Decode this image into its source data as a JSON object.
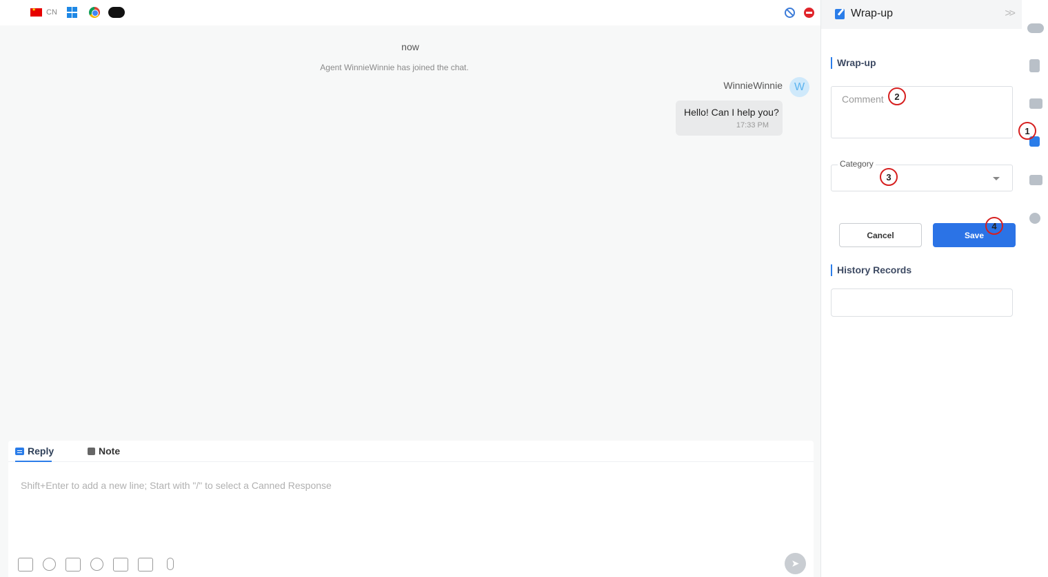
{
  "topbar": {
    "language_code": "CN",
    "icons": [
      "china-flag-icon",
      "windows-icon",
      "chrome-icon",
      "salesforce-icon",
      "block-icon",
      "end-chat-icon"
    ]
  },
  "chat": {
    "timestamp": "now",
    "system_message": "Agent WinnieWinnie has joined the chat.",
    "messages": [
      {
        "sender": "WinnieWinnie",
        "avatar_letter": "W",
        "text": "Hello! Can I help you?",
        "time": "17:33 PM"
      }
    ]
  },
  "composer": {
    "tabs": [
      {
        "label": "Reply",
        "active": true
      },
      {
        "label": "Note",
        "active": false
      }
    ],
    "placeholder": "Shift+Enter to add a new line; Start with \"/\" to select a Canned Response",
    "tool_icons": [
      "folder-icon",
      "emoji-icon",
      "image-icon",
      "transfer-agent-icon",
      "clipboard-add-icon",
      "video-icon",
      "microphone-icon"
    ]
  },
  "wrapup": {
    "title": "Wrap-up",
    "section_title": "Wrap-up",
    "comment_placeholder": "Comment",
    "category_label": "Category",
    "category_value": "",
    "cancel_label": "Cancel",
    "save_label": "Save",
    "history_title": "History Records"
  },
  "annotations": [
    "1",
    "2",
    "3",
    "4"
  ],
  "rail": {
    "icons": [
      "salesforce-cloud-icon",
      "clipboard-info-icon",
      "contact-card-icon",
      "wrap-up-edit-icon",
      "knowledge-book-icon",
      "history-clock-icon"
    ],
    "active": "wrap-up-edit-icon"
  },
  "colors": {
    "accent": "#2b73e6",
    "annotation_red": "#d61f1f",
    "stop_red": "#e0242a"
  }
}
